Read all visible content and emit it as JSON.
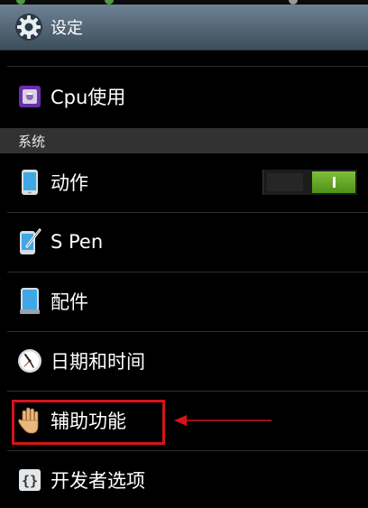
{
  "actionbar": {
    "title": "设定",
    "icon": "gear-icon"
  },
  "items": [
    {
      "label": "Cpu使用",
      "icon": "cpu-icon"
    },
    {
      "label": "动作",
      "icon": "phone-motion-icon",
      "toggle": true
    },
    {
      "label": "S Pen",
      "icon": "s-pen-icon"
    },
    {
      "label": "配件",
      "icon": "accessory-icon"
    },
    {
      "label": "日期和时间",
      "icon": "clock-icon"
    },
    {
      "label": "辅助功能",
      "icon": "hand-icon",
      "highlighted": true
    },
    {
      "label": "开发者选项",
      "icon": "braces-icon"
    }
  ],
  "section": {
    "header": "系统"
  },
  "colors": {
    "highlight": "#d5131a",
    "toggle_on": "#6aae2c",
    "actionbar": "#586b7c"
  }
}
